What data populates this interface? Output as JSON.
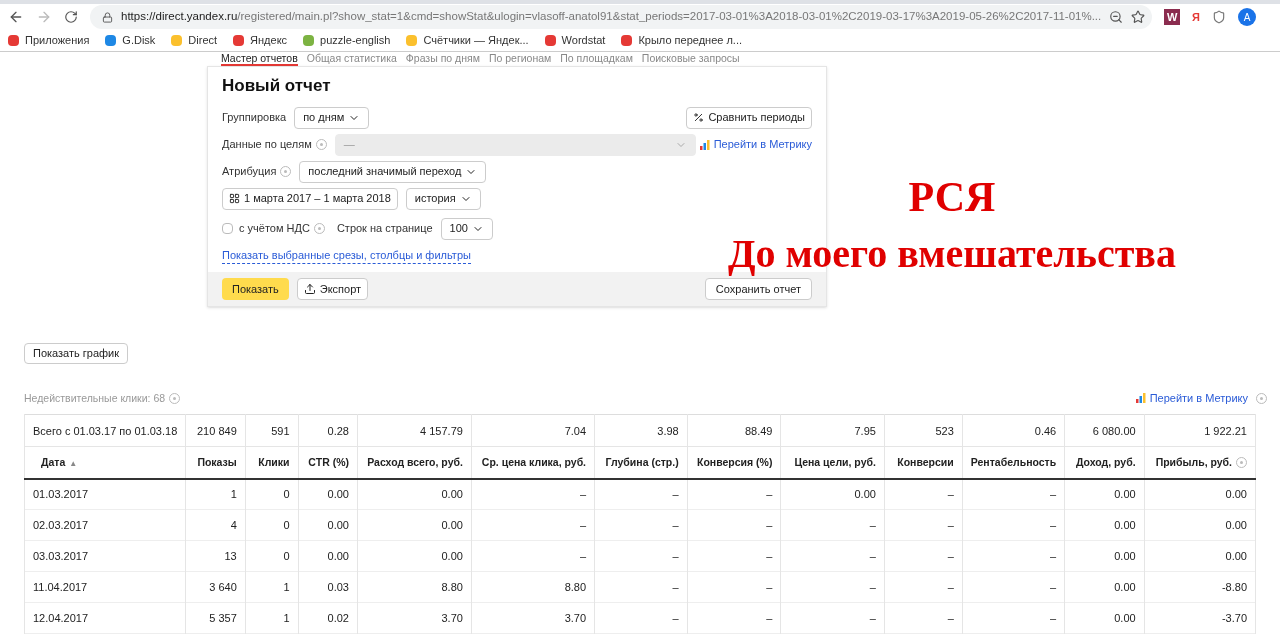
{
  "browser": {
    "url_host": "https://direct.yandex.ru",
    "url_rest": "/registered/main.pl?show_stat=1&cmd=showStat&ulogin=vlasoff-anatol91&stat_periods=2017-03-01%3A2018-03-01%2C2019-03-17%3A2019-05-26%2C2017-11-01%...",
    "extensions": [
      "W",
      "Я"
    ],
    "profile": "A",
    "bookmarks": [
      {
        "label": "Приложения",
        "color": "#e53935"
      },
      {
        "label": "G.Disk",
        "color": "#1e88e5"
      },
      {
        "label": "Direct",
        "color": "#fbc02d"
      },
      {
        "label": "Яндекс",
        "color": "#e53935"
      },
      {
        "label": "puzzle-english",
        "color": "#7cb342"
      },
      {
        "label": "Счётчики — Яндек...",
        "color": "#fbc02d"
      },
      {
        "label": "Wordstat",
        "color": "#e53935"
      },
      {
        "label": "Крыло переднее л...",
        "color": "#e53935"
      }
    ]
  },
  "tabs": [
    {
      "label": "Мастер отчетов",
      "selected": true
    },
    {
      "label": "Общая статистика",
      "selected": false
    },
    {
      "label": "Фразы по дням",
      "selected": false
    },
    {
      "label": "По регионам",
      "selected": false
    },
    {
      "label": "По площадкам",
      "selected": false
    },
    {
      "label": "Поисковые запросы",
      "selected": false
    }
  ],
  "report": {
    "title": "Новый отчет",
    "grouping": {
      "label": "Группировка",
      "value": "по дням"
    },
    "compare_button": "Сравнить периоды",
    "goals": {
      "label": "Данные по целям",
      "help": true,
      "placeholder": "—"
    },
    "metrika_link": "Перейти в Метрику",
    "attribution": {
      "label": "Атрибуция",
      "help": true,
      "value": "последний значимый переход"
    },
    "date_range": "1 марта 2017 – 1 марта 2018",
    "history": "история",
    "vat": {
      "label": "с учётом НДС",
      "checked": false,
      "help": true
    },
    "rows_per_page": {
      "label": "Строк на странице",
      "value": "100"
    },
    "filters_link": "Показать выбранные срезы, столбцы и фильтры",
    "show_button": "Показать",
    "export_button": "Экспорт",
    "save_button": "Сохранить отчет"
  },
  "annotation": {
    "title": "РСЯ",
    "subtitle": "До моего вмешательства"
  },
  "show_chart_button": "Показать график",
  "invalid_clicks": {
    "label": "Недействительные клики: 68",
    "help": true
  },
  "metrika_link": "Перейти в Метрику",
  "table": {
    "totals": [
      "Всего с 01.03.17 по 01.03.18",
      "210 849",
      "591",
      "0.28",
      "4 157.79",
      "7.04",
      "3.98",
      "88.49",
      "7.95",
      "523",
      "0.46",
      "6 080.00",
      "1 922.21"
    ],
    "columns": [
      {
        "label": "Дата",
        "sort_mark": "▲",
        "help": false
      },
      {
        "label": "Показы",
        "help": false
      },
      {
        "label": "Клики",
        "help": false
      },
      {
        "label": "CTR (%)",
        "help": false
      },
      {
        "label": "Расход всего, руб.",
        "help": false
      },
      {
        "label": "Ср. цена клика, руб.",
        "help": false
      },
      {
        "label": "Глубина (стр.)",
        "help": false
      },
      {
        "label": "Конверсия (%)",
        "help": false
      },
      {
        "label": "Цена цели, руб.",
        "help": false
      },
      {
        "label": "Конверсии",
        "help": false
      },
      {
        "label": "Рентабельность",
        "help": false
      },
      {
        "label": "Доход, руб.",
        "help": false
      },
      {
        "label": "Прибыль, руб.",
        "help": true
      }
    ],
    "rows": [
      [
        "01.03.2017",
        "1",
        "0",
        "0.00",
        "0.00",
        "–",
        "–",
        "–",
        "0.00",
        "–",
        "–",
        "0.00",
        "0.00"
      ],
      [
        "02.03.2017",
        "4",
        "0",
        "0.00",
        "0.00",
        "–",
        "–",
        "–",
        "–",
        "–",
        "–",
        "0.00",
        "0.00"
      ],
      [
        "03.03.2017",
        "13",
        "0",
        "0.00",
        "0.00",
        "–",
        "–",
        "–",
        "–",
        "–",
        "–",
        "0.00",
        "0.00"
      ],
      [
        "11.04.2017",
        "3 640",
        "1",
        "0.03",
        "8.80",
        "8.80",
        "–",
        "–",
        "–",
        "–",
        "–",
        "0.00",
        "-8.80"
      ],
      [
        "12.04.2017",
        "5 357",
        "1",
        "0.02",
        "3.70",
        "3.70",
        "–",
        "–",
        "–",
        "–",
        "–",
        "0.00",
        "-3.70"
      ]
    ]
  }
}
